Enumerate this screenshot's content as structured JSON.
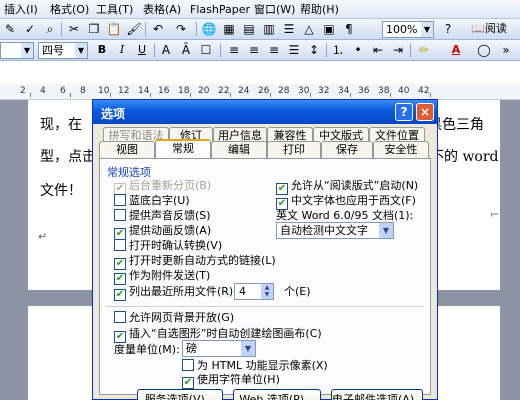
{
  "menubar": {
    "items": [
      "插入(I)",
      "格式(O)",
      "工具(T)",
      "表格(A)",
      "FlashPaper",
      "窗口(W)",
      "帮助(H)"
    ]
  },
  "toolbar1": {
    "zoom_value": "100%",
    "read_label": "阅读"
  },
  "toolbar2": {
    "font_size_value": "四号",
    "bold": "B",
    "italic": "I",
    "underline": "U",
    "font_color": "A"
  },
  "ruler": {
    "numbers": [
      "2",
      "4",
      "6",
      "8",
      "10",
      "12",
      "14",
      "16",
      "18",
      "20",
      "22",
      "24",
      "26",
      "28",
      "30",
      "32",
      "34",
      "36",
      "38",
      "40",
      "42"
    ]
  },
  "document": {
    "line1_left": "现，在",
    "line1_right": "黑色三角",
    "line2_left": "型，点击",
    "line2_right": "不的 word",
    "line3_left": "文件！"
  },
  "dialog": {
    "title": "选项",
    "help": "?",
    "close": "×",
    "tabs_row1": [
      "拼写和语法",
      "修订",
      "用户信息",
      "兼容性",
      "中文版式",
      "文件位置"
    ],
    "tabs_row2": [
      "视图",
      "常规",
      "编辑",
      "打印",
      "保存",
      "安全性"
    ],
    "active_tab": "常规",
    "section_title": "常规选项",
    "options_left": [
      {
        "label": "后台重新分页(B)",
        "checked": true,
        "disabled": true
      },
      {
        "label": "蓝底白字(U)",
        "checked": false,
        "disabled": false
      },
      {
        "label": "提供声音反馈(S)",
        "checked": false,
        "disabled": false
      },
      {
        "label": "提供动画反馈(A)",
        "checked": true,
        "disabled": false
      },
      {
        "label": "打开时确认转换(V)",
        "checked": false,
        "disabled": false
      },
      {
        "label": "打开时更新自动方式的链接(L)",
        "checked": true,
        "disabled": false
      },
      {
        "label": "作为附件发送(T)",
        "checked": true,
        "disabled": false
      },
      {
        "label": "列出最近所用文件(R):",
        "checked": true,
        "disabled": false
      }
    ],
    "recent_files_count": "4",
    "recent_files_unit": "个(E)",
    "options_right": [
      {
        "label": "允许从“阅读版式”启动(N)",
        "checked": true
      },
      {
        "label": "中文字体也应用于西文(F)",
        "checked": true
      }
    ],
    "word_compat_label": "英文 Word 6.0/95 文档(1):",
    "word_compat_value": "自动检测中文文字",
    "options_lower": [
      {
        "label": "允许网页背景开放(G)",
        "checked": false
      },
      {
        "label": "插入“自选图形”时自动创建绘图画布(C)",
        "checked": true
      }
    ],
    "unit_label": "度量单位(M):",
    "unit_value": "磅",
    "options_unit": [
      {
        "label": "为 HTML 功能显示像素(X)",
        "checked": false
      },
      {
        "label": "使用字符单位(H)",
        "checked": true
      }
    ],
    "buttons": [
      "服务选项(V)...",
      "Web 选项(P)...",
      "电子邮件选项(A)..."
    ]
  }
}
